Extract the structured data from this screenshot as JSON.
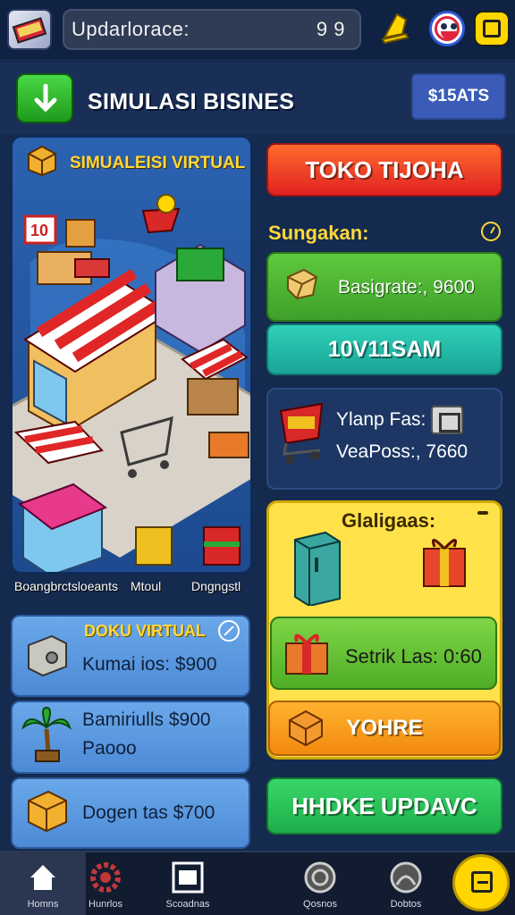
{
  "topbar": {
    "search_text": "Updarlorace:",
    "counter": "9 9",
    "icons": [
      "app-logo-icon",
      "bell-icon",
      "face-icon",
      "smile-icon"
    ]
  },
  "header": {
    "title": "SIMULASI BISINES",
    "stats_label": "$15ATS"
  },
  "scene": {
    "title": "SIMUALEISI VIRTUAL",
    "sign_number": "10",
    "labels": [
      "Boangbrctsloeants",
      "Mtoul",
      "Dngngstl"
    ]
  },
  "right": {
    "toko_button": "TOKO TIJOHA",
    "section_title": "Sungakan:",
    "green_card_text": "Basigrate:, 9600",
    "teal_button": "10V11SAM",
    "cart_line1": "Ylanp Fas:",
    "cart_line2": "VeaPoss:, 7660",
    "yellow_title": "Glaligaas:",
    "setrik_text": "Setrik Las: 0:60",
    "orange_button": "YOHRE",
    "green_button": "HHDKE UPDAVC"
  },
  "left": {
    "doku_title": "DOKU VIRTUAL",
    "kumai_text": "Kumai ios: $900",
    "bamin_line1": "Bamiriulls $900",
    "bamin_line2": "Paooo",
    "dogen_text": "Dogen tas $700"
  },
  "nav": {
    "items": [
      "Homns",
      "Hunrlos",
      "Scoadnas",
      "Qosnos",
      "Dobtos"
    ]
  },
  "colors": {
    "background": "#142a4e",
    "accent_yellow": "#ffd83a",
    "red_button": "#e02222",
    "green_button": "#1fae4a"
  }
}
